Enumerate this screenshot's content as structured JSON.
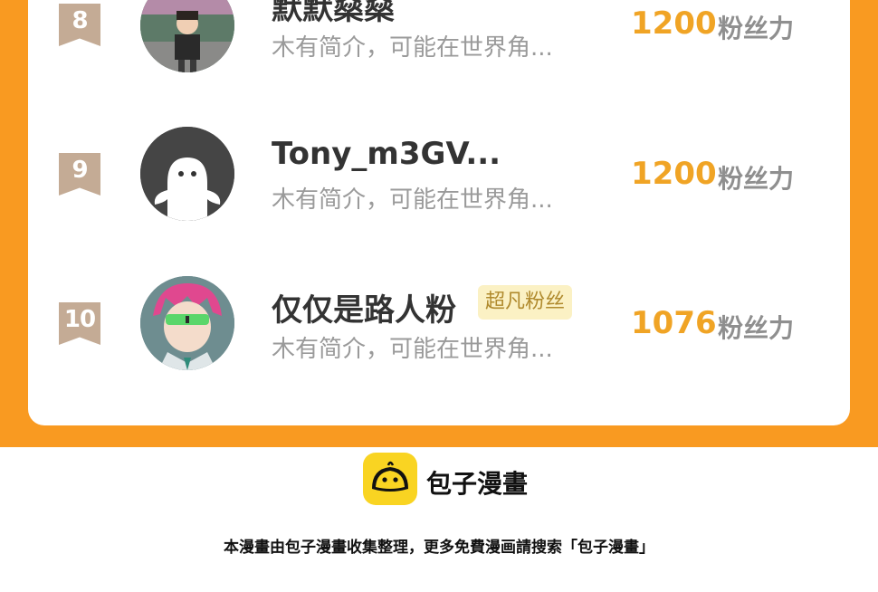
{
  "leaderboard": {
    "rows": [
      {
        "rank": "8",
        "name": "默默燊燊",
        "bio": "木有简介，可能在世界角...",
        "score": "1200",
        "score_unit": "粉丝力",
        "avatar_icon": "child-photo-avatar"
      },
      {
        "rank": "9",
        "name": "Tony_m3GV...",
        "bio": "木有简介，可能在世界角...",
        "score": "1200",
        "score_unit": "粉丝力",
        "avatar_icon": "default-ghost-avatar"
      },
      {
        "rank": "10",
        "name": "仅仅是路人粉",
        "badge": "超凡粉丝",
        "bio": "木有简介，可能在世界角...",
        "score": "1076",
        "score_unit": "粉丝力",
        "avatar_icon": "anime-pink-hair-avatar"
      }
    ]
  },
  "footer": {
    "brand": "包子漫畫",
    "note": "本漫畫由包子漫畫收集整理，更多免費漫画請搜索「包子漫畫」",
    "logo_icon": "baozi-bun-icon"
  },
  "colors": {
    "accent": "#f99a21",
    "score": "#f0a425",
    "rank_ribbon": "#c4ab95",
    "badge_bg": "#fbf1c4",
    "logo_yellow": "#f9d422"
  }
}
